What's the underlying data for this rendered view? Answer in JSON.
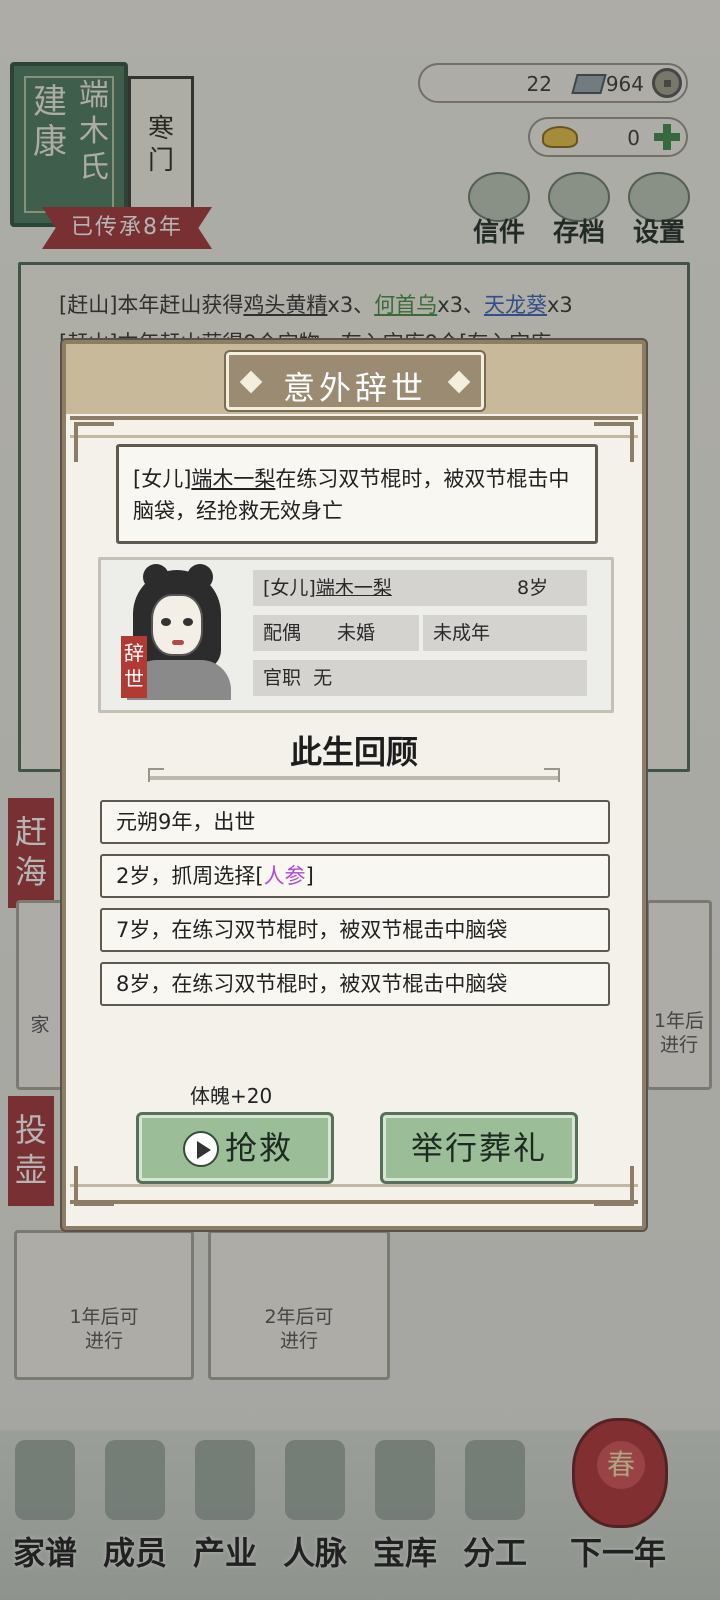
{
  "family": {
    "name_col1": "建康",
    "name_col2": "端木氏",
    "status": "寒门",
    "inherited": "已传承8年"
  },
  "resources": {
    "silver_count": "22",
    "coin_count": "964",
    "gold_count": "0"
  },
  "top_buttons": {
    "letters": "信件",
    "save": "存档",
    "settings": "设置"
  },
  "log": {
    "line1_prefix": "[赶山]本年赶山获得",
    "line1_item1": "鸡头黄精",
    "line1_mid1": "x3、",
    "line1_item2": "何首乌",
    "line1_mid2": "x3、",
    "line1_item3": "天龙葵",
    "line1_suffix": "x3",
    "line2": "[赶山]本年赶山获得9个宝物，存入宝库9个[存入宝库"
  },
  "background_cards": {
    "sea_tag": "赶海",
    "pot_tag": "投壶",
    "card_left_text": "家",
    "card_right_text": "1年后\n进行",
    "card1": "1年后可\n进行",
    "card2": "2年后可\n进行"
  },
  "modal": {
    "title": "意外辞世",
    "description_prefix": "[女儿]",
    "description_name": "端木一梨",
    "description_suffix": "在练习双节棍时，被双节棍击中脑袋，经抢救无效身亡",
    "seal": "辞世",
    "character": {
      "relation": "[女儿]",
      "name": "端木一梨",
      "age": "8岁",
      "spouse_label": "配偶",
      "spouse_value": "未婚",
      "adult_status": "未成年",
      "office_label": "官职",
      "office_value": "无"
    },
    "review_title": "此生回顾",
    "events": [
      {
        "text": "元朔9年，出世"
      },
      {
        "prefix": "2岁，抓周选择[",
        "highlight": "人参",
        "suffix": "]"
      },
      {
        "text": "7岁，在练习双节棍时，被双节棍击中脑袋"
      },
      {
        "text": "8岁，在练习双节棍时，被双节棍击中脑袋"
      }
    ],
    "bonus": "体魄+20",
    "rescue_label": "抢救",
    "funeral_label": "举行葬礼"
  },
  "nav": [
    {
      "label": "家谱"
    },
    {
      "label": "成员"
    },
    {
      "label": "产业"
    },
    {
      "label": "人脉"
    },
    {
      "label": "宝库"
    },
    {
      "label": "分工"
    },
    {
      "label": "下一年"
    }
  ],
  "lantern_char": "春",
  "colors": {
    "accent_green": "#9bbd98",
    "frame_brown": "#8c7e66",
    "seal_red": "#b13a35",
    "highlight_purple": "#b04ad0"
  }
}
